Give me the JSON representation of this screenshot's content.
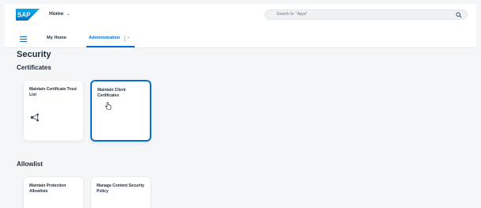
{
  "shell": {
    "logo_text": "SAP",
    "home_label": "Home",
    "home_chevron": "⌄",
    "search_placeholder": "Search In: \"Apps\"",
    "brand_color": "#0a6ed1"
  },
  "nav": {
    "tabs": [
      {
        "label": "My Home"
      },
      {
        "label": "Administration"
      }
    ],
    "tab_chevron": "⌄"
  },
  "page": {
    "title": "Security",
    "sections": [
      {
        "heading": "Certificates",
        "tiles": [
          {
            "title": "Maintain Certificate Trust List",
            "icon": "share-icon"
          },
          {
            "title": "Maintain Client Certificates",
            "selected": true
          }
        ]
      },
      {
        "heading": "Allowlist",
        "tiles": [
          {
            "title": "Maintain Protection Allowlists"
          },
          {
            "title": "Manage Content Security Policy"
          }
        ]
      }
    ]
  }
}
